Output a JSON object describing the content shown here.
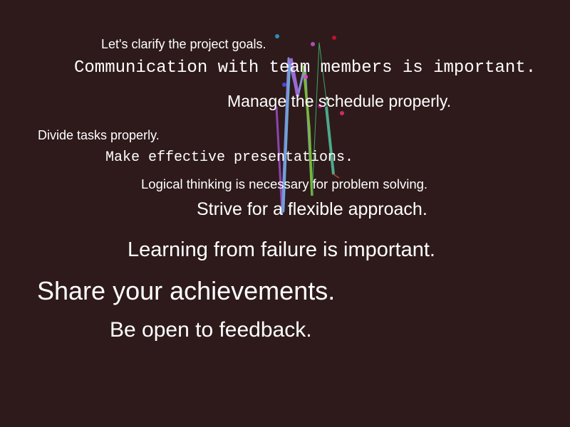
{
  "background_color": "#2e1a1b",
  "text_color": "#ffffff",
  "phrases": [
    "Let's clarify the project goals.",
    "Communication with team members is important.",
    "Manage the schedule properly.",
    "Divide tasks properly.",
    "Make effective presentations.",
    "Logical thinking is necessary for problem solving.",
    "Strive for a flexible approach.",
    "Learning from failure is important.",
    "Share your achievements.",
    "Be open to feedback."
  ],
  "scribble_colors": [
    "#8e44ad",
    "#7f8fdc",
    "#6aa8d8",
    "#79b83a",
    "#4ca98b",
    "#9b6ad3",
    "#3aaa6a",
    "#b5482a"
  ],
  "dot_colors": [
    "#2a8fb5",
    "#c0102a",
    "#b04fb0",
    "#4a4ad0",
    "#cc4fcc",
    "#e0e0e0",
    "#b0108a",
    "#d02a6a"
  ]
}
